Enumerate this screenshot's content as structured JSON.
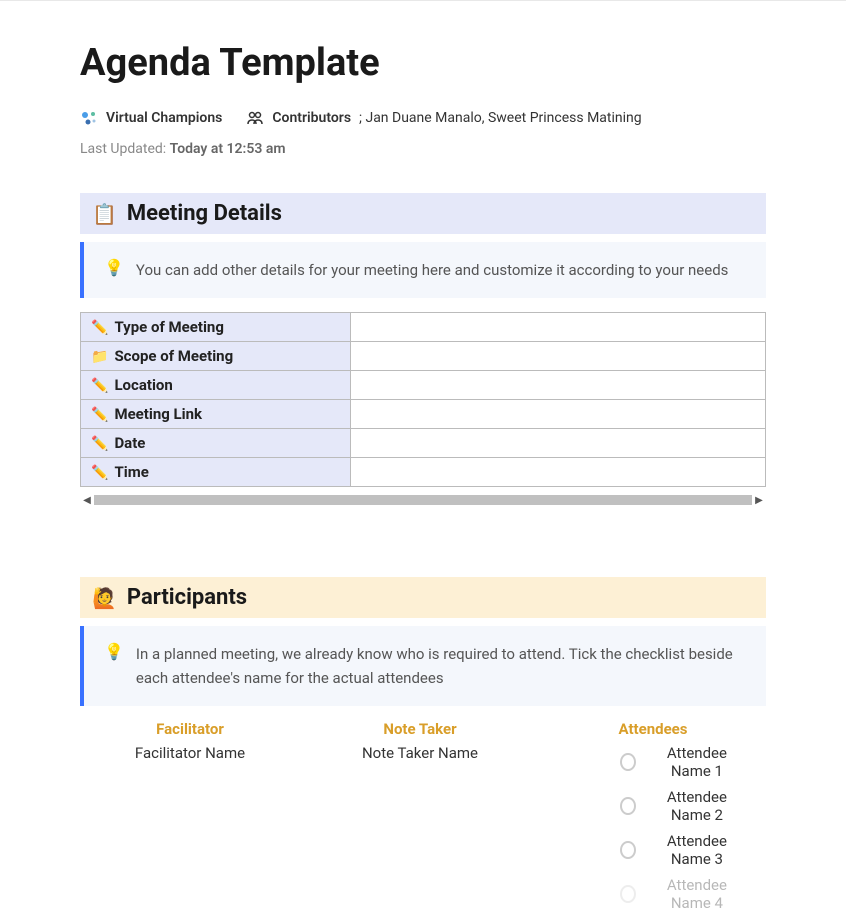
{
  "page": {
    "title": "Agenda Template",
    "workspace": "Virtual Champions",
    "contributors_label": "Contributors",
    "contributors_value": "; Jan Duane Manalo, Sweet Princess Matining",
    "last_updated_label": "Last Updated: ",
    "last_updated_value": "Today at 12:53 am"
  },
  "meeting_details": {
    "title": "Meeting Details",
    "callout": "You can add other details for your meeting here and customize it according to your needs",
    "rows": [
      {
        "icon": "pencil",
        "label": "Type of Meeting",
        "value": ""
      },
      {
        "icon": "folder",
        "label": "Scope of Meeting",
        "value": ""
      },
      {
        "icon": "pencil",
        "label": "Location",
        "value": ""
      },
      {
        "icon": "pencil",
        "label": "Meeting Link",
        "value": ""
      },
      {
        "icon": "pencil",
        "label": "Date",
        "value": ""
      },
      {
        "icon": "pencil",
        "label": "Time",
        "value": ""
      }
    ]
  },
  "participants": {
    "title": "Participants",
    "callout": "In a planned meeting, we already know who is required to attend. Tick the checklist beside each attendee's name for the actual attendees",
    "facilitator": {
      "header": "Facilitator",
      "name": "Facilitator Name"
    },
    "note_taker": {
      "header": "Note Taker",
      "name": "Note Taker Name"
    },
    "attendees": {
      "header": "Attendees",
      "items": [
        "Attendee Name 1",
        "Attendee Name 2",
        "Attendee Name 3",
        "Attendee Name 4"
      ]
    }
  }
}
